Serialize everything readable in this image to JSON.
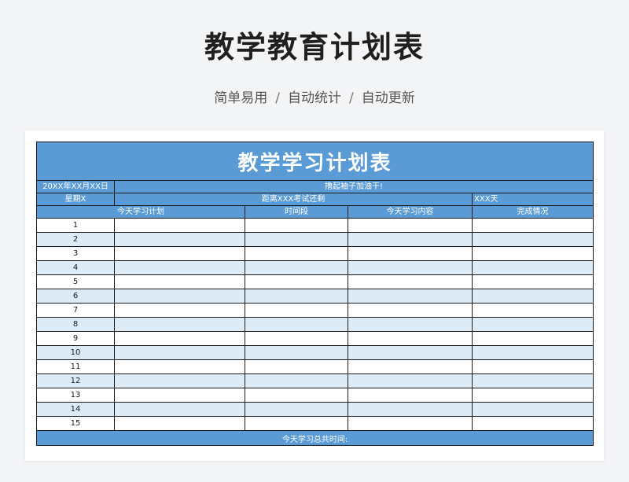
{
  "page": {
    "title": "教学教育计划表",
    "subtitle_parts": [
      "简单易用",
      "自动统计",
      "自动更新"
    ],
    "separator": "/"
  },
  "sheet": {
    "title": "教学学习计划表",
    "date": "20XX年XX月XX日",
    "motto": "撸起袖子加油干!",
    "weekday": "星期X",
    "countdown_label": "距离XXX考试还剩",
    "countdown_value": "XXX天",
    "columns": [
      "今天学习计划",
      "时间段",
      "今天学习内容",
      "完成情况"
    ],
    "row_numbers": [
      "1",
      "2",
      "3",
      "4",
      "5",
      "6",
      "7",
      "8",
      "9",
      "10",
      "11",
      "12",
      "13",
      "14",
      "15"
    ],
    "footer": "今天学习总共时间:"
  },
  "colors": {
    "header_blue": "#5b9bd5",
    "stripe_blue": "#ddebf7",
    "border": "#1a1a1a"
  }
}
